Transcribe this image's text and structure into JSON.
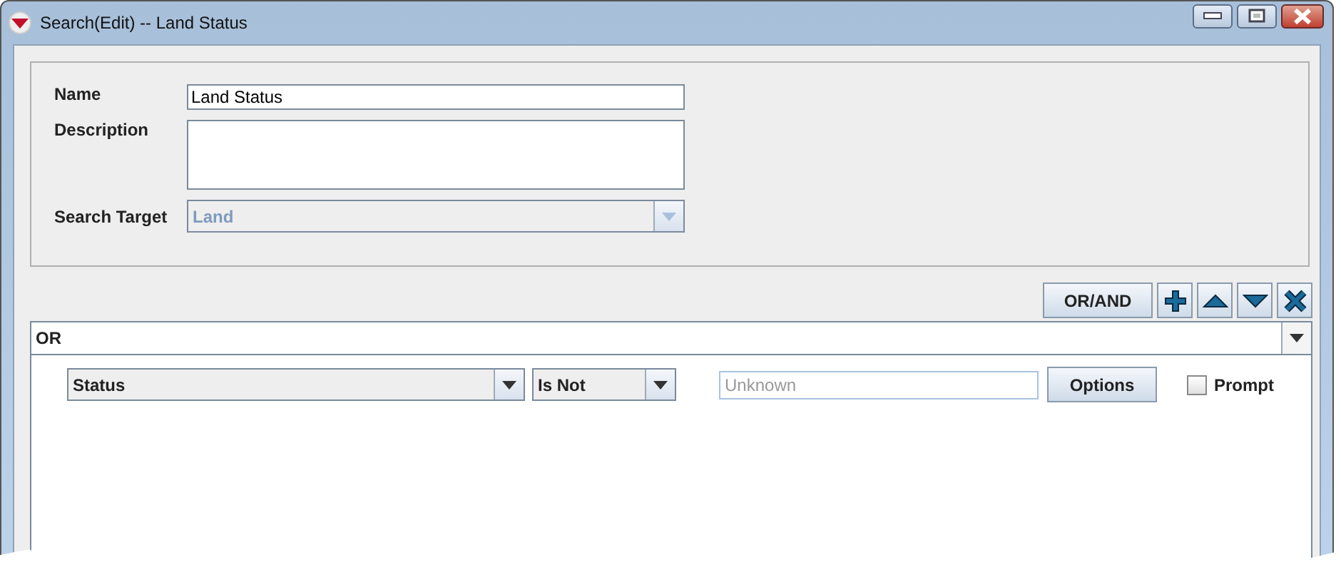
{
  "window": {
    "title": "Search(Edit) -- Land Status"
  },
  "form": {
    "name_label": "Name",
    "name_value": "Land Status",
    "description_label": "Description",
    "target_label": "Search Target",
    "target_value": "Land",
    "target_disabled": true
  },
  "toolbar": {
    "mode_button": "OR/AND"
  },
  "group": {
    "operator": "OR"
  },
  "conditions": [
    {
      "field": "Status",
      "comparison": "Is Not",
      "value_placeholder": "Unknown",
      "options_button": "Options",
      "prompt_label": "Prompt",
      "prompt_checked": false
    }
  ]
}
